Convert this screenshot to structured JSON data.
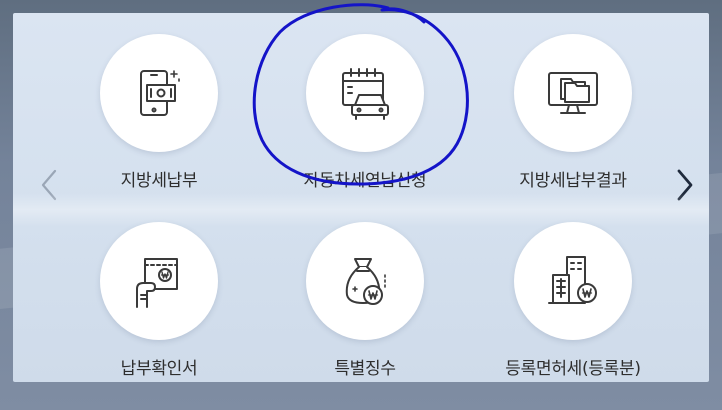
{
  "menu": {
    "items": [
      {
        "label": "지방세납부",
        "icon": "mobile-bill-icon"
      },
      {
        "label": "자동차세연납신청",
        "icon": "car-calendar-icon"
      },
      {
        "label": "지방세납부결과",
        "icon": "monitor-folder-icon"
      },
      {
        "label": "납부확인서",
        "icon": "receipt-won-icon"
      },
      {
        "label": "특별징수",
        "icon": "money-bag-won-icon"
      },
      {
        "label": "등록면허세(등록분)",
        "icon": "building-won-icon"
      }
    ]
  },
  "nav": {
    "prev_icon": "chevron-left-icon",
    "next_icon": "chevron-right-icon"
  },
  "colors": {
    "panel": "#d4e0ee",
    "icon_stroke": "#3a3a3a",
    "annotation": "#1414c8",
    "next_arrow": "#1f2a3c",
    "prev_arrow": "#9aa6b6"
  }
}
